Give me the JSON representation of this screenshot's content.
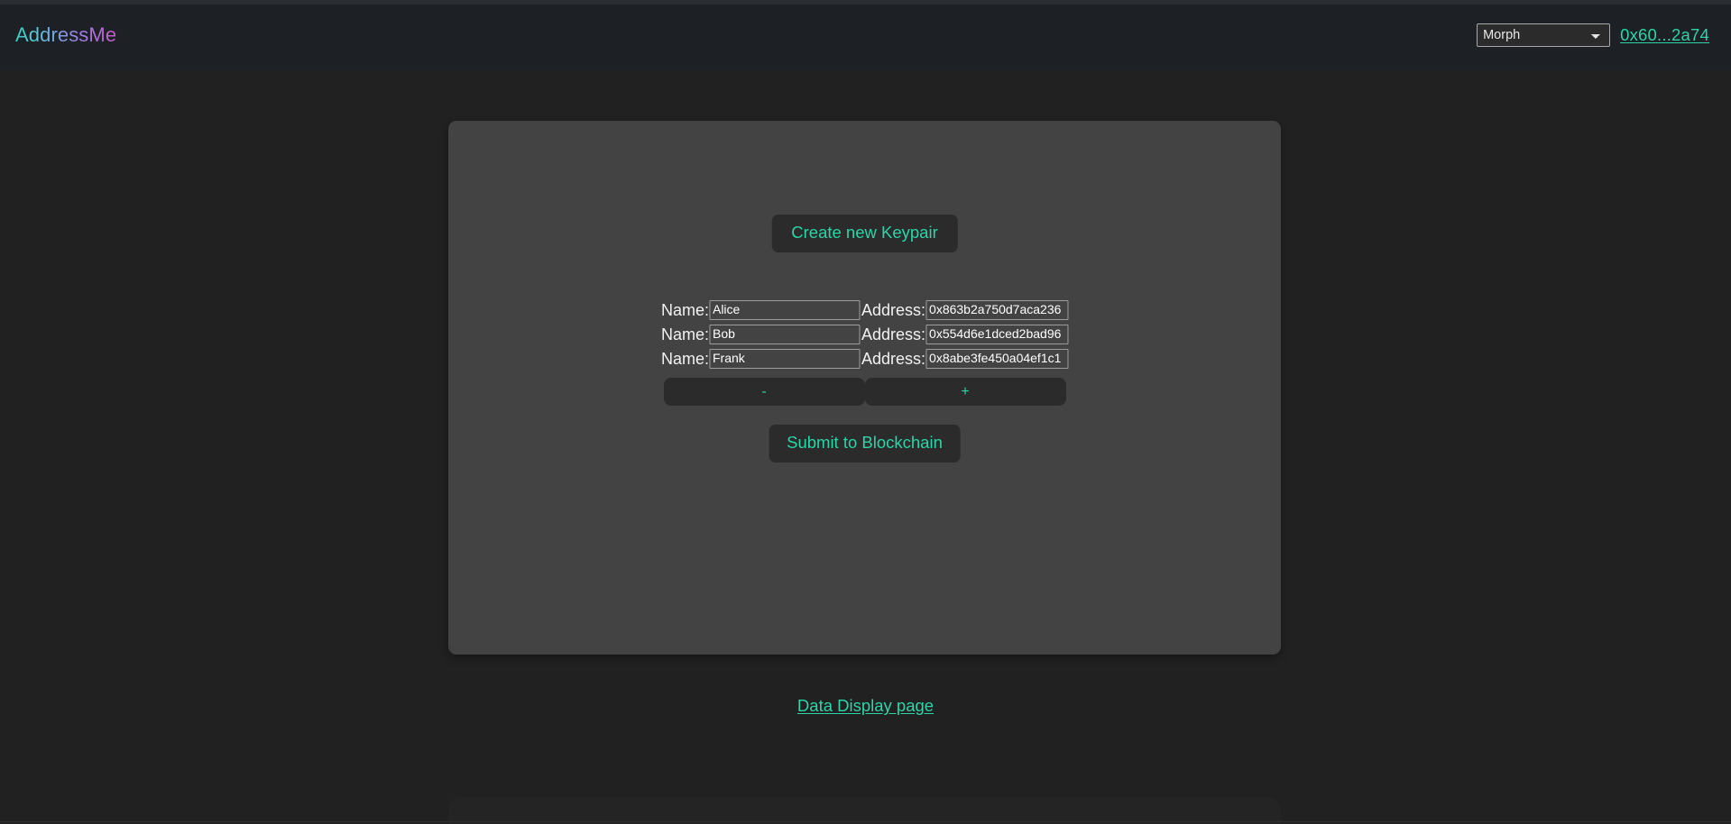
{
  "navbar": {
    "brand": "AddressMe",
    "chain_select": {
      "selected": "Morph",
      "options": [
        "Morph"
      ],
      "icon": "chevron-down-icon"
    },
    "wallet_link": "0x60...2a74"
  },
  "card": {
    "create_keypair_label": "Create new Keypair",
    "name_label": "Name:",
    "address_label": "Address:",
    "rows": [
      {
        "name": "Alice",
        "address": "0x863b2a750d7aca236"
      },
      {
        "name": "Bob",
        "address": "0x554d6e1dced2bad96"
      },
      {
        "name": "Frank",
        "address": "0x8abe3fe450a04ef1c1"
      }
    ],
    "remove_row_label": "-",
    "add_row_label": "+",
    "submit_label": "Submit to Blockchain"
  },
  "footer": {
    "data_display_link": "Data Display page"
  },
  "colors": {
    "accent_teal": "#2dd4a8",
    "page_background": "#212121",
    "navbar_background": "#1d2025",
    "card_background": "#434343",
    "button_background": "#2b2b2b",
    "input_border": "#9d9d9d",
    "text_primary": "#f2f2f2"
  }
}
